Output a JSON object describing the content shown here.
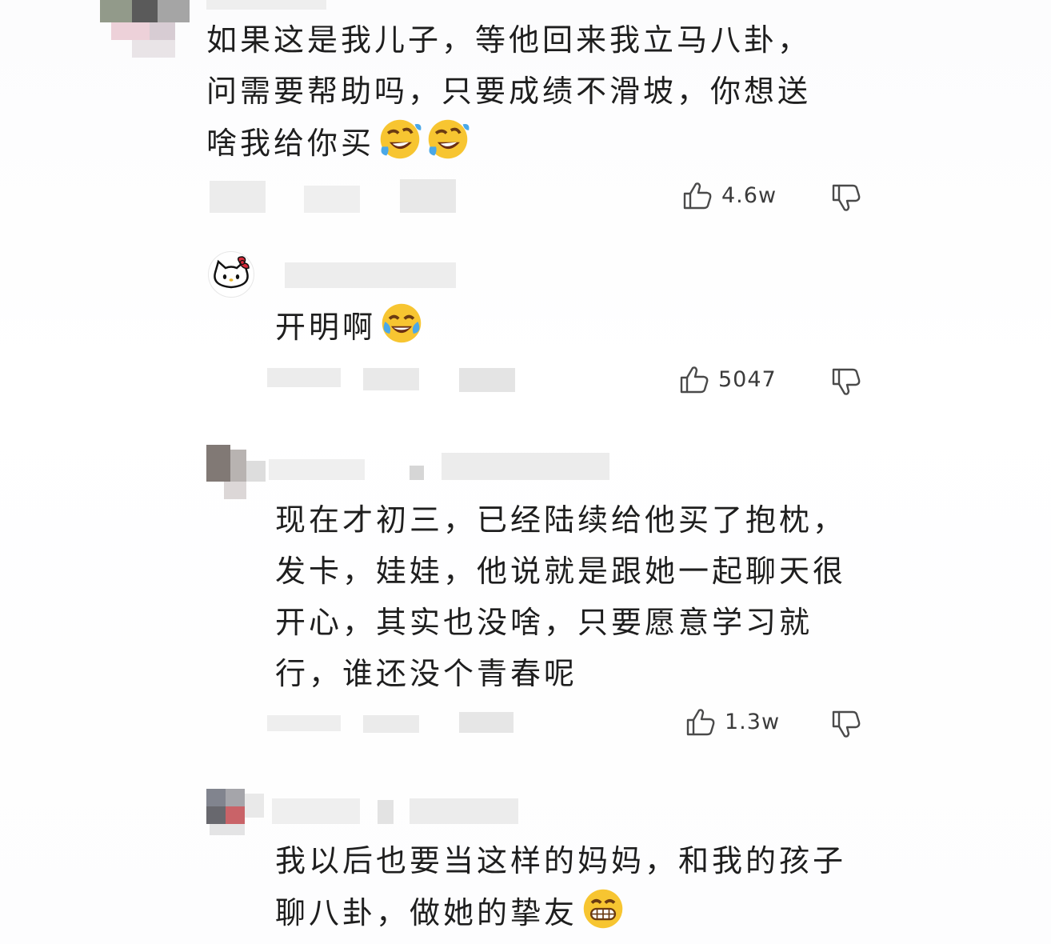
{
  "comments": [
    {
      "lines": [
        "如果这是我儿子，等他回来我立马八卦，",
        "问需要帮助吗，只要成绩不滑坡，你想送",
        "啥我给你买"
      ],
      "emojis": [
        "rofl-emoji",
        "rofl-emoji"
      ],
      "likes": "4.6w"
    },
    {
      "lines": [
        "开明啊"
      ],
      "emojis": [
        "tears-of-joy-emoji"
      ],
      "likes": "5047"
    },
    {
      "lines": [
        "现在才初三，已经陆续给他买了抱枕，",
        "发卡，娃娃，他说就是跟她一起聊天很",
        "开心，其实也没啥，只要愿意学习就",
        "行，谁还没个青春呢"
      ],
      "emojis": [],
      "likes": "1.3w"
    },
    {
      "lines": [
        "我以后也要当这样的妈妈，和我的孩子",
        "聊八卦，做她的挚友"
      ],
      "emojis": [
        "grinning-emoji"
      ],
      "likes": ""
    }
  ],
  "icons": {
    "like": "thumbs-up-icon",
    "dislike": "thumbs-down-icon",
    "avatar_reply": "hello-kitty-avatar"
  },
  "colors": {
    "text": "#1e1e1e",
    "count": "#3b3b3b",
    "icon": "#4a4a4a",
    "emoji_yellow": "#f7c531"
  }
}
